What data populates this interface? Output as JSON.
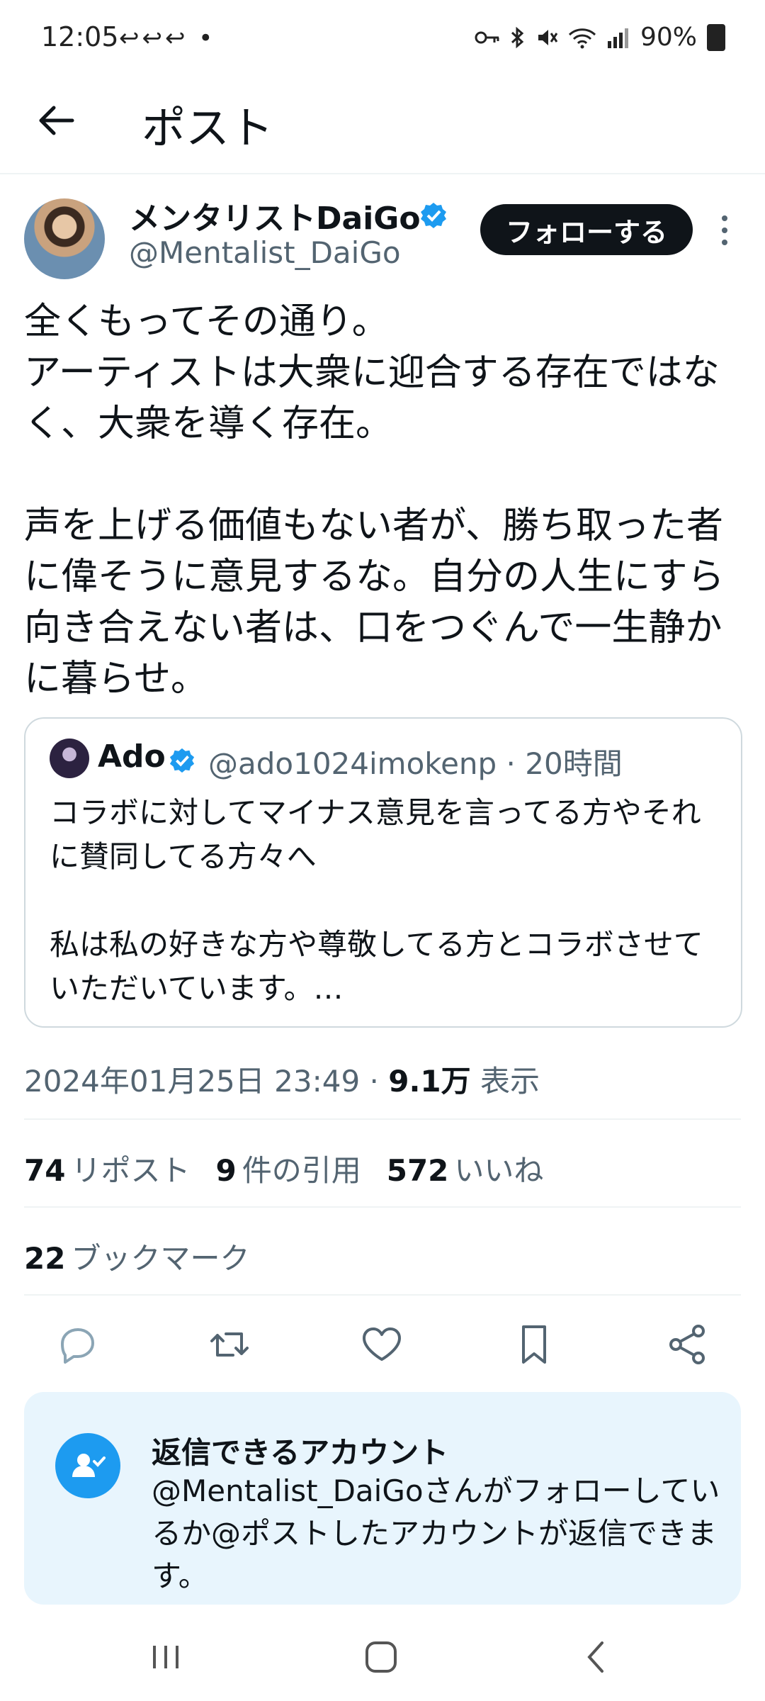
{
  "status_bar": {
    "time": "12:05",
    "left_icons": "↩↩↩ •",
    "battery": "90%"
  },
  "header": {
    "title": "ポスト"
  },
  "author": {
    "name": "メンタリストDaiGo",
    "handle": "@Mentalist_DaiGo",
    "follow_label": "フォローする"
  },
  "post": {
    "text": "全くもってその通り。\nアーティストは大衆に迎合する存在ではなく、大衆を導く存在。\n\n声を上げる価値もない者が、勝ち取った者に偉そうに意見するな。自分の人生にすら向き合えない者は、口をつぐんで一生静かに暮らせ。"
  },
  "quote": {
    "name": "Ado",
    "handle_time": "@ado1024imokenp · 20時間",
    "text": "コラボに対してマイナス意見を言ってる方やそれに賛同してる方々へ\n\n私は私の好きな方や尊敬してる方とコラボさせていただいています。…"
  },
  "meta": {
    "timestamp": "2024年01月25日 23:49 · ",
    "views_count": "9.1万",
    "views_label": " 表示"
  },
  "stats": {
    "reposts_count": "74",
    "reposts_label": "リポスト",
    "quotes_count": "9",
    "quotes_label": "件の引用",
    "likes_count": "572",
    "likes_label": "いいね",
    "bookmarks_count": "22",
    "bookmarks_label": "ブックマーク"
  },
  "reply_box": {
    "title": "返信できるアカウント",
    "text": "@Mentalist_DaiGoさんがフォローしているか@ポストしたアカウントが返信できます。"
  },
  "colors": {
    "accent": "#1d9bf0",
    "text": "#0f1419",
    "muted": "#536471",
    "reply_bg": "#e8f5fd"
  }
}
